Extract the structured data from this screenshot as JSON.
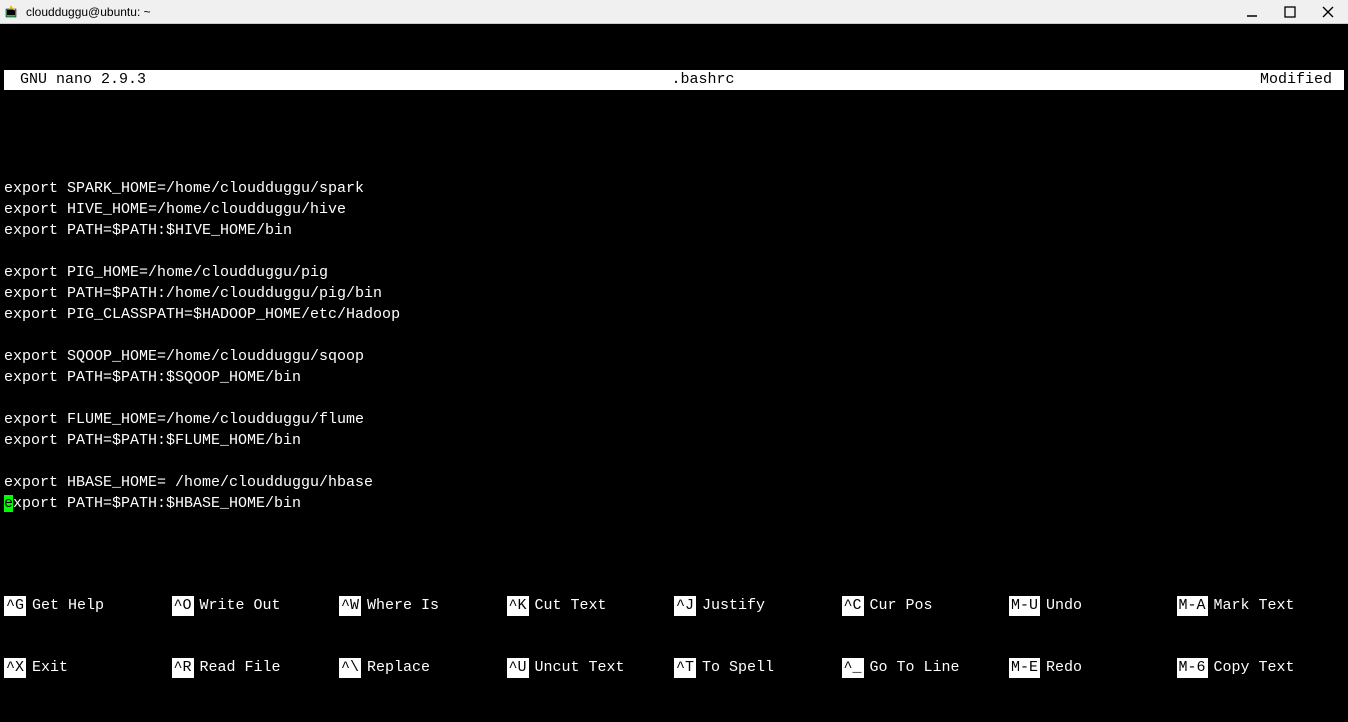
{
  "window": {
    "title": "cloudduggu@ubuntu: ~"
  },
  "nano": {
    "header_left": "GNU nano 2.9.3",
    "header_center": ".bashrc",
    "header_right": "Modified"
  },
  "editor_lines": [
    "",
    "export SPARK_HOME=/home/cloudduggu/spark",
    "export HIVE_HOME=/home/cloudduggu/hive",
    "export PATH=$PATH:$HIVE_HOME/bin",
    "",
    "export PIG_HOME=/home/cloudduggu/pig",
    "export PATH=$PATH:/home/cloudduggu/pig/bin",
    "export PIG_CLASSPATH=$HADOOP_HOME/etc/Hadoop",
    "",
    "export SQOOP_HOME=/home/cloudduggu/sqoop",
    "export PATH=$PATH:$SQOOP_HOME/bin",
    "",
    "export FLUME_HOME=/home/cloudduggu/flume",
    "export PATH=$PATH:$FLUME_HOME/bin",
    "",
    "export HBASE_HOME= /home/cloudduggu/hbase"
  ],
  "cursor_line": {
    "before": "",
    "cursor": "e",
    "after": "xport PATH=$PATH:$HBASE_HOME/bin"
  },
  "footer": {
    "row1": [
      {
        "key": "^G",
        "label": "Get Help"
      },
      {
        "key": "^O",
        "label": "Write Out"
      },
      {
        "key": "^W",
        "label": "Where Is"
      },
      {
        "key": "^K",
        "label": "Cut Text"
      },
      {
        "key": "^J",
        "label": "Justify"
      },
      {
        "key": "^C",
        "label": "Cur Pos"
      },
      {
        "key": "M-U",
        "label": "Undo"
      },
      {
        "key": "M-A",
        "label": "Mark Text"
      }
    ],
    "row2": [
      {
        "key": "^X",
        "label": "Exit"
      },
      {
        "key": "^R",
        "label": "Read File"
      },
      {
        "key": "^\\",
        "label": "Replace"
      },
      {
        "key": "^U",
        "label": "Uncut Text"
      },
      {
        "key": "^T",
        "label": "To Spell"
      },
      {
        "key": "^_",
        "label": "Go To Line"
      },
      {
        "key": "M-E",
        "label": "Redo"
      },
      {
        "key": "M-6",
        "label": "Copy Text"
      }
    ]
  }
}
